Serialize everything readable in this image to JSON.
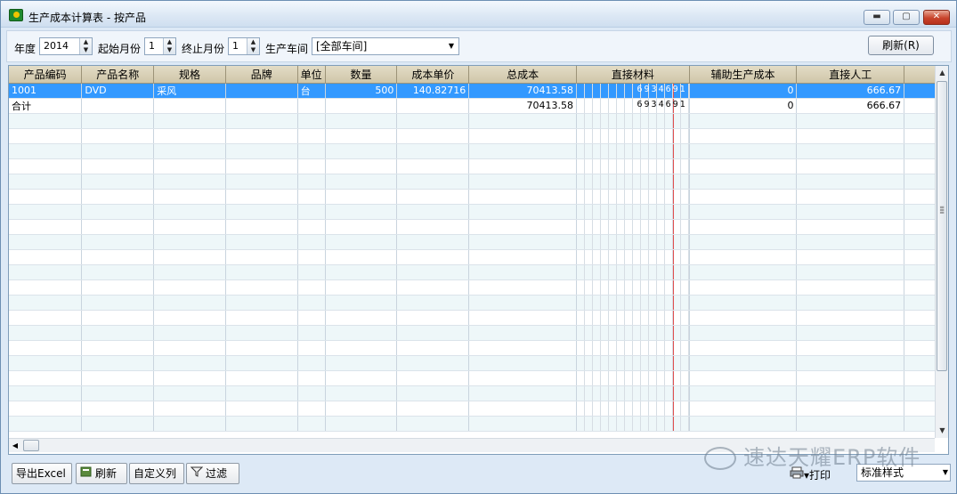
{
  "window": {
    "title": "生产成本计算表 - 按产品",
    "min": "▬",
    "max": "▢",
    "close": "✕"
  },
  "filters": {
    "year_label": "年度",
    "year": "2014",
    "start_label": "起始月份",
    "start": "1",
    "end_label": "终止月份",
    "end": "1",
    "workshop_label": "生产车间",
    "workshop": "[全部车间]",
    "refresh": "刷新(R)"
  },
  "table": {
    "columns": [
      "产品编码",
      "产品名称",
      "规格",
      "品牌",
      "单位",
      "数量",
      "成本单价",
      "总成本",
      "直接材料",
      "辅助生产成本",
      "直接人工"
    ],
    "rows": [
      {
        "code": "1001",
        "name": "DVD",
        "spec": "采风",
        "brand": "",
        "unit": "台",
        "qty": "500",
        "unit_cost": "140.82716",
        "total": "70413.58",
        "material": "6934691",
        "aux": "0",
        "labor": "666.67"
      },
      {
        "code": "合计",
        "name": "",
        "spec": "",
        "brand": "",
        "unit": "",
        "qty": "",
        "unit_cost": "",
        "total": "70413.58",
        "material": "6934691",
        "aux": "0",
        "labor": "666.67"
      }
    ]
  },
  "bottom": {
    "export": "导出Excel",
    "refresh": "刷新",
    "custom_columns": "自定义列",
    "filter": "过滤",
    "print": "▾打印",
    "style": "标准样式"
  },
  "watermark": "速达天耀ERP软件",
  "icons": {
    "app": "app-icon",
    "spin": "spin-arrows-icon",
    "dropdown": "chevron-down-icon"
  }
}
